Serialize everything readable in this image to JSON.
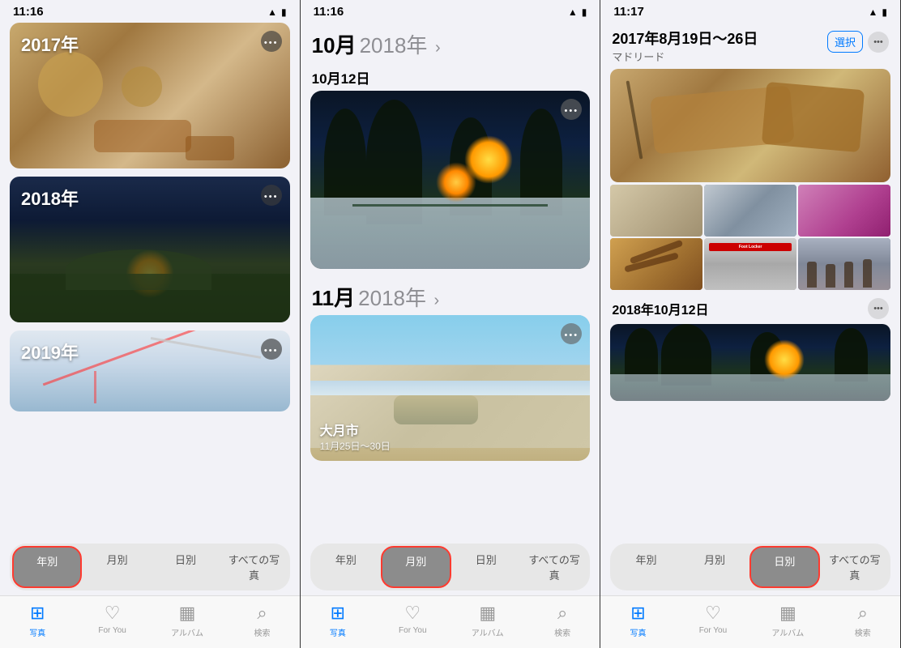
{
  "panels": [
    {
      "id": "panel1",
      "status_time": "11:16",
      "view": "year",
      "years": [
        {
          "label": "2017年",
          "bg": "food"
        },
        {
          "label": "2018年",
          "bg": "night"
        },
        {
          "label": "2019年",
          "bg": "map"
        }
      ],
      "tabs": [
        "年別",
        "月別",
        "日別",
        "すべての写真"
      ],
      "active_tab": "年別",
      "bottom_tabs": [
        "写真",
        "For You",
        "アルバム",
        "検索"
      ],
      "active_bottom": "写真"
    },
    {
      "id": "panel2",
      "status_time": "11:16",
      "view": "month",
      "month_sections": [
        {
          "month": "10月",
          "year": "2018年",
          "dates": [
            {
              "label": "10月12日",
              "bg": "night-oct"
            }
          ]
        },
        {
          "month": "11月",
          "year": "2018年",
          "memories": [
            {
              "title": "大月市",
              "dates": "11月25日〜30日",
              "bg": "airplane"
            }
          ]
        }
      ],
      "tabs": [
        "年別",
        "月別",
        "日別",
        "すべての写真"
      ],
      "active_tab": "月別",
      "bottom_tabs": [
        "写真",
        "For You",
        "アルバム",
        "検索"
      ],
      "active_bottom": "写真"
    },
    {
      "id": "panel3",
      "status_time": "11:17",
      "view": "day",
      "header_title": "2017年8月19日〜26日",
      "header_subtitle": "マドリード",
      "select_btn": "選択",
      "more_btn": "···",
      "sections": [
        {
          "date": "2018年10月12日"
        }
      ],
      "tabs": [
        "年別",
        "月別",
        "日別",
        "すべての写真"
      ],
      "active_tab": "日別",
      "bottom_tabs": [
        "写真",
        "For You",
        "アルバム",
        "検索"
      ],
      "active_bottom": "写真"
    }
  ],
  "icons": {
    "photos": "🖼",
    "for_you": "❤️",
    "album": "📁",
    "search": "🔍",
    "wifi": "📶",
    "battery": "🔋",
    "more": "•••"
  }
}
